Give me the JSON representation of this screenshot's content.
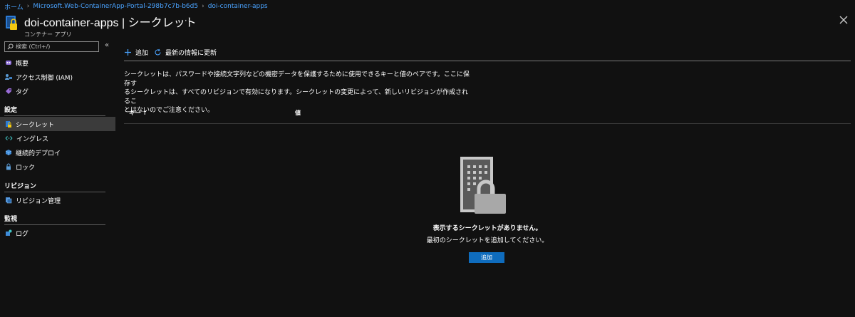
{
  "breadcrumb": {
    "items": [
      "ホーム",
      "Microsoft.Web-ContainerApp-Portal-298b7c7b-b6d5",
      "doi-container-apps"
    ]
  },
  "header": {
    "title": "doi-container-apps | シークレット",
    "subtitle": "コンテナー アプリ",
    "more": "···",
    "close": "×"
  },
  "sidebar": {
    "search_placeholder": "検索 (Ctrl+/)",
    "collapse": "«",
    "top_items": [
      {
        "label": "概要",
        "icon": "overview-icon"
      },
      {
        "label": "アクセス制御 (IAM)",
        "icon": "iam-icon"
      },
      {
        "label": "タグ",
        "icon": "tag-icon"
      }
    ],
    "sections": [
      {
        "title": "設定",
        "items": [
          {
            "label": "シークレット",
            "icon": "key-lock-icon",
            "active": true
          },
          {
            "label": "イングレス",
            "icon": "ingress-icon"
          },
          {
            "label": "継続的デプロイ",
            "icon": "cube-icon"
          },
          {
            "label": "ロック",
            "icon": "lock-icon"
          }
        ]
      },
      {
        "title": "リビジョン",
        "items": [
          {
            "label": "リビジョン管理",
            "icon": "revision-icon"
          }
        ]
      },
      {
        "title": "監視",
        "items": [
          {
            "label": "ログ",
            "icon": "logs-icon"
          }
        ]
      }
    ]
  },
  "toolbar": {
    "add_label": "追加",
    "refresh_label": "最新の情報に更新"
  },
  "description": {
    "lines": [
      "シークレットは、パスワードや接続文字列などの機密データを保護するために使用できるキーと値のペアです。ここに保存す",
      "るシークレットは、すべてのリビジョンで有効になります。シークレットの変更によって、新しいリビジョンが作成されるこ",
      "とはないのでご注意ください。"
    ]
  },
  "table": {
    "col_key": "キー ↑",
    "col_value": "値"
  },
  "empty_state": {
    "title": "表示するシークレットがありません。",
    "subtitle": "最初のシークレットを追加してください。",
    "button": "追加"
  },
  "colors": {
    "background": "#111111",
    "accent": "#0f6cbd",
    "link": "#4aa3ff",
    "active_row": "#3b3b3b"
  }
}
